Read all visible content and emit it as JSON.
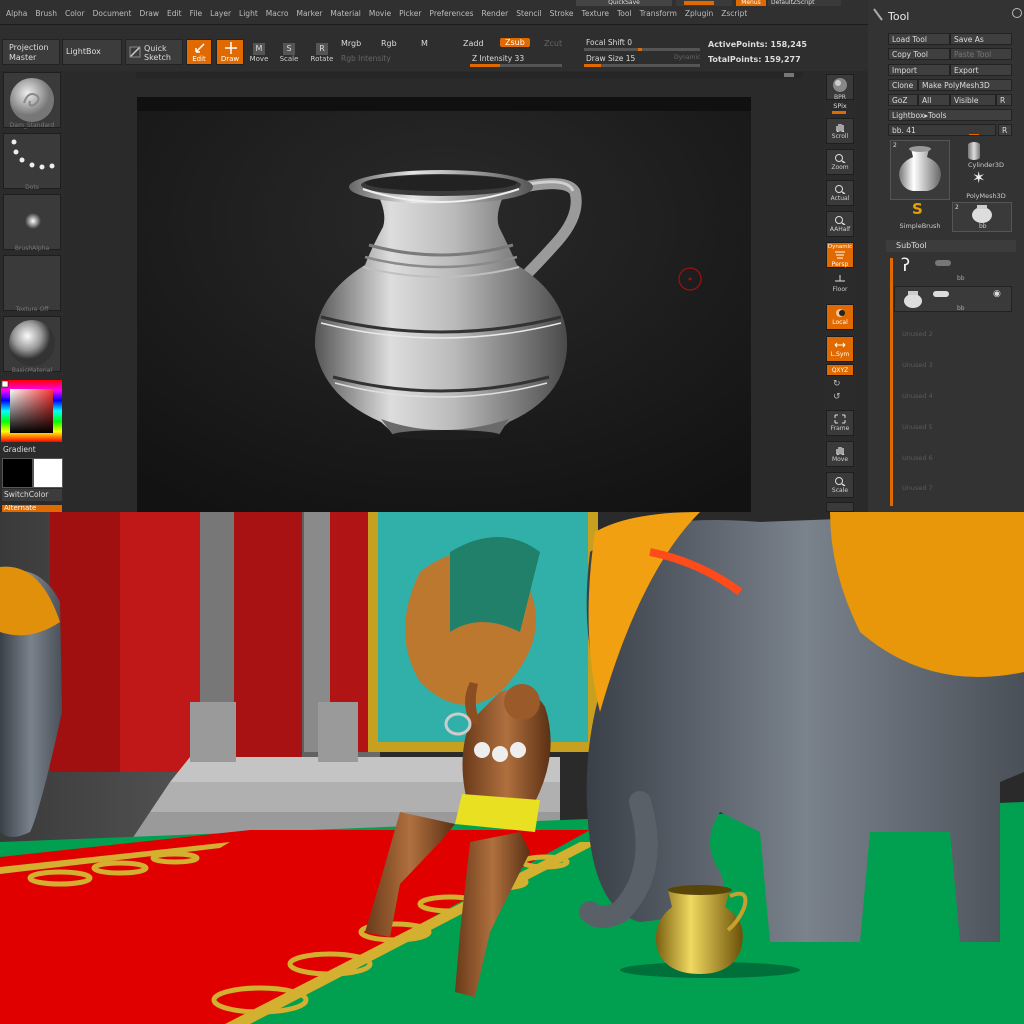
{
  "menubar": {
    "items": [
      "Alpha",
      "Brush",
      "Color",
      "Document",
      "Draw",
      "Edit",
      "File",
      "Layer",
      "Light",
      "Macro",
      "Marker",
      "Material",
      "Movie",
      "Picker",
      "Preferences",
      "Render",
      "Stencil",
      "Stroke",
      "Texture",
      "Tool",
      "Transform",
      "Zplugin",
      "Zscript"
    ],
    "quicksave": "QuickSave",
    "menus": "Menus",
    "default_script": "DefaultZScript"
  },
  "toolbar": {
    "projection_master": "Projection Master",
    "lightbox": "LightBox",
    "quick_sketch": "Quick Sketch",
    "edit": "Edit",
    "draw": "Draw",
    "move": "Move",
    "scale": "Scale",
    "rotate": "Rotate",
    "mrgb": "Mrgb",
    "rgb": "Rgb",
    "m": "M",
    "zadd": "Zadd",
    "zsub": "Zsub",
    "zcut": "Zcut",
    "rgb_intensity": "Rgb Intensity",
    "z_intensity": "Z Intensity 33",
    "focal_shift": "Focal Shift 0",
    "draw_size": "Draw Size 15",
    "dynamic": "Dynamic",
    "active_points": "ActivePoints: 158,245",
    "total_points": "TotalPoints: 159,277",
    "z_intensity_value": 33,
    "focal_shift_value": 0,
    "draw_size_value": 15
  },
  "leftshelf": {
    "brush": "Dam_Standard",
    "stroke": "Dots",
    "alpha": "BrushAlpha",
    "texture": "Texture Off",
    "material": "BasicMaterial",
    "gradient": "Gradient",
    "switch_color": "SwitchColor",
    "alternate": "Alternate"
  },
  "rightshelf": {
    "bpr": "BPR",
    "spix": "SPix",
    "scroll": "Scroll",
    "zoom": "Zoom",
    "actual": "Actual",
    "aahalf": "AAHalf",
    "persp": "Persp",
    "dynamic": "Dynamic",
    "floor": "Floor",
    "local": "Local",
    "lsym": "L.Sym",
    "xyz": "QXYZ",
    "frame": "Frame",
    "move": "Move",
    "scale": "Scale"
  },
  "toolpanel": {
    "title": "Tool",
    "load_tool": "Load Tool",
    "save_as": "Save As",
    "copy_tool": "Copy Tool",
    "paste_tool": "Paste Tool",
    "import": "Import",
    "export": "Export",
    "clone": "Clone",
    "make_polymesh": "Make PolyMesh3D",
    "goz": "GoZ",
    "all": "All",
    "visible": "Visible",
    "r": "R",
    "lightbox_tools": "Lightbox▸Tools",
    "bb_slider": "bb. 41",
    "tool_count": "2",
    "cylinder": "Cylinder3D",
    "polymesh": "PolyMesh3D",
    "simplebrush": "SimpleBrush",
    "bb": "bb",
    "bb_tile_count": "2",
    "subtool_title": "SubTool",
    "subtool_1": "bb",
    "subtool_2": "bb",
    "unused": [
      "Unused 2",
      "Unused 3",
      "Unused 4",
      "Unused 5",
      "Unused 6",
      "Unused 7"
    ]
  },
  "colors": {
    "accent": "#e06a00",
    "panel": "#333333",
    "carpet": "#e10000",
    "floor": "#00a050",
    "gold": "#d4b030"
  }
}
